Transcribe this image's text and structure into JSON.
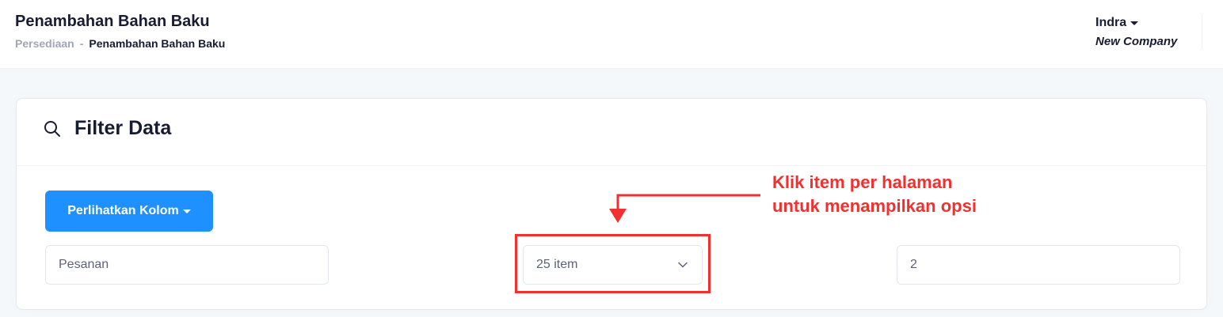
{
  "header": {
    "page_title": "Penambahan Bahan Baku",
    "breadcrumb": {
      "parent": "Persediaan",
      "separator": "-",
      "current": "Penambahan Bahan Baku"
    },
    "user": {
      "name": "Indra",
      "company": "New Company"
    }
  },
  "filter_card": {
    "title": "Filter Data",
    "title_icon": "search-icon",
    "show_columns_button": "Perlihatkan Kolom",
    "search_input": {
      "value": "Pesanan"
    },
    "items_per_page_select": {
      "value": "25 item"
    },
    "page_input": {
      "value": "2"
    }
  },
  "annotation": {
    "line1": "Klik item per halaman",
    "line2": "untuk menampilkan opsi",
    "color": "#f23030"
  },
  "colors": {
    "primary": "#1e90ff",
    "text_dark": "#181c32",
    "text_muted": "#a1a5b7",
    "annotation_red": "#f23030"
  }
}
